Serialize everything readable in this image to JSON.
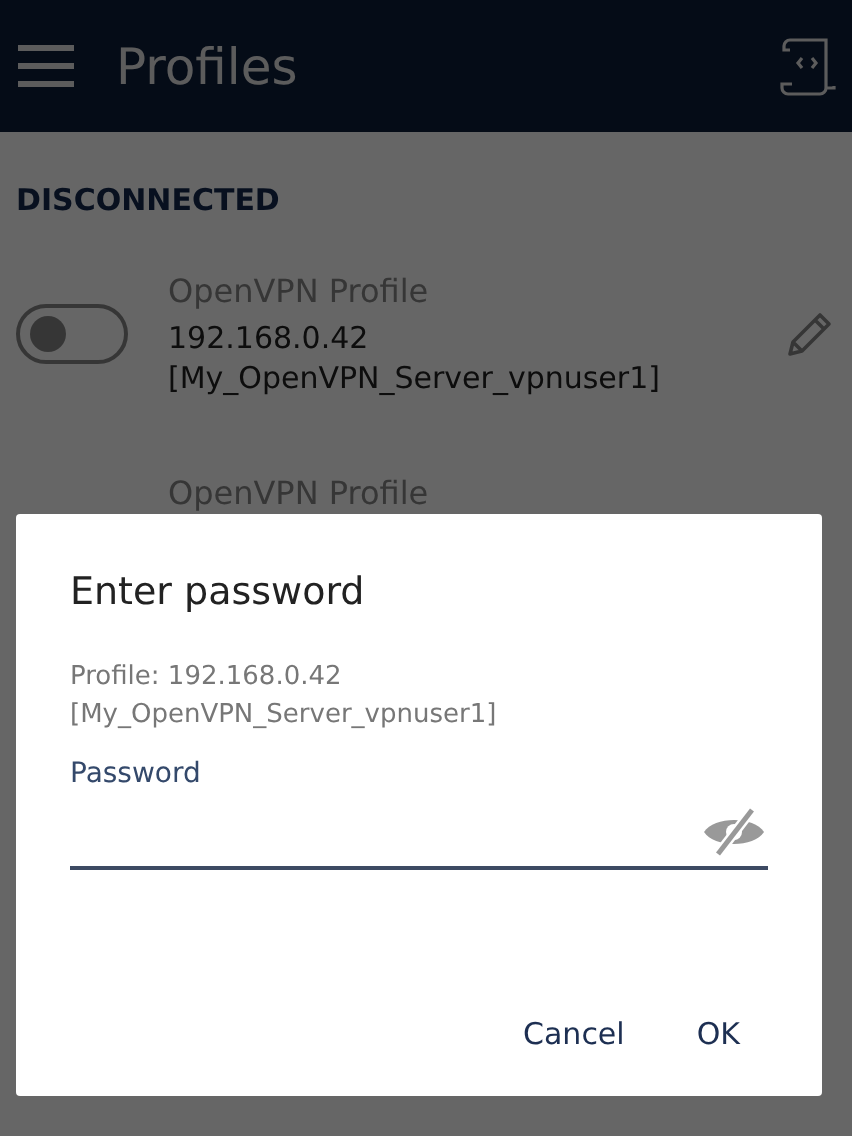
{
  "app_bar": {
    "title": "Profiles"
  },
  "section": {
    "title": "DISCONNECTED"
  },
  "profiles": [
    {
      "name": "OpenVPN Profile",
      "address": "192.168.0.42",
      "server": "[My_OpenVPN_Server_vpnuser1]",
      "on": false
    },
    {
      "name": "OpenVPN Profile"
    }
  ],
  "dialog": {
    "title": "Enter password",
    "profile_line": "Profile: 192.168.0.42",
    "server_line": "[My_OpenVPN_Server_vpnuser1]",
    "field_label": "Password",
    "password_visible": false,
    "buttons": [
      "Cancel",
      "OK"
    ]
  }
}
